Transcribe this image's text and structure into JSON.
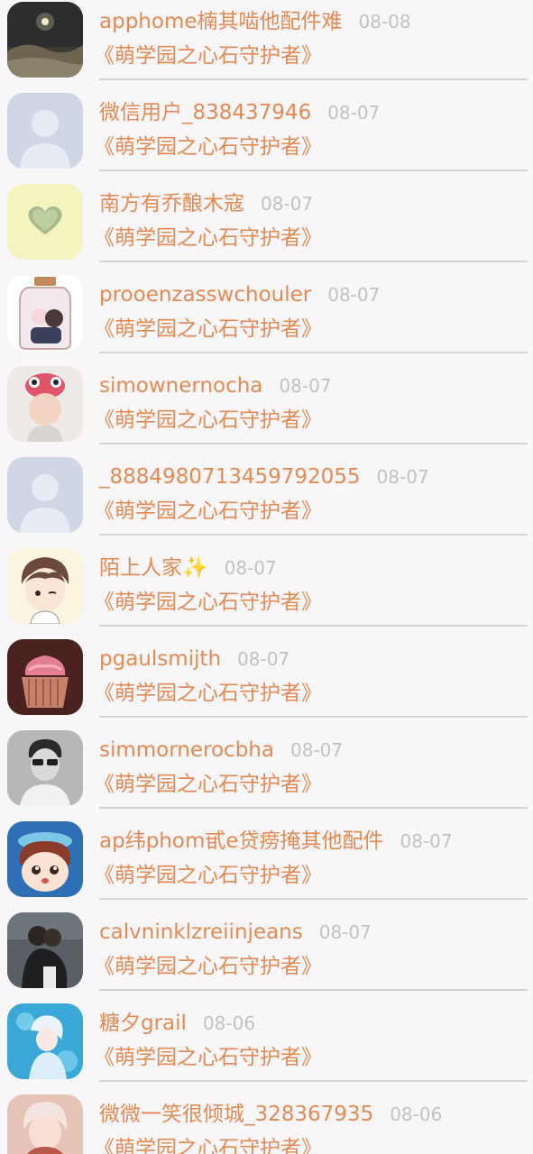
{
  "colors": {
    "background": "#f8f6f8",
    "accent_text": "#e58a52",
    "date_text": "#c4c1c4",
    "divider": "#d6d4d6"
  },
  "items": [
    {
      "name": "apphome楠其啮他配件难",
      "date": "08-08",
      "subtitle": "《萌学园之心石守护者》",
      "avatar_icon": "night-landscape-avatar"
    },
    {
      "name": "微信用户_838437946",
      "date": "08-07",
      "subtitle": "《萌学园之心石守护者》",
      "avatar_icon": "default-person-avatar"
    },
    {
      "name": "南方有乔酿木寇",
      "date": "08-07",
      "subtitle": "《萌学园之心石守护者》",
      "avatar_icon": "heart-avatar"
    },
    {
      "name": "prooenzasswchouler",
      "date": "08-07",
      "subtitle": "《萌学园之心石守护者》",
      "avatar_icon": "jar-illustration-avatar"
    },
    {
      "name": "simownernocha",
      "date": "08-07",
      "subtitle": "《萌学园之心石守护者》",
      "avatar_icon": "baby-photo-avatar"
    },
    {
      "name": "_8884980713459792055",
      "date": "08-07",
      "subtitle": "《萌学园之心石守护者》",
      "avatar_icon": "default-person-avatar"
    },
    {
      "name": "陌上人家✨",
      "date": "08-07",
      "subtitle": "《萌学园之心石守护者》",
      "avatar_icon": "anime-boy-avatar"
    },
    {
      "name": "pgaulsmijth",
      "date": "08-07",
      "subtitle": "《萌学园之心石守护者》",
      "avatar_icon": "cupcake-avatar"
    },
    {
      "name": "simmornerocbha",
      "date": "08-07",
      "subtitle": "《萌学园之心石守护者》",
      "avatar_icon": "bw-portrait-avatar"
    },
    {
      "name": "ap纬phom甙e贷痨掩其他配件",
      "date": "08-07",
      "subtitle": "《萌学园之心石守护者》",
      "avatar_icon": "cartoon-mascot-avatar"
    },
    {
      "name": "calvninklzreiinjeans",
      "date": "08-07",
      "subtitle": "《萌学园之心石守护者》",
      "avatar_icon": "couple-photo-avatar"
    },
    {
      "name": "糖夕grail",
      "date": "08-06",
      "subtitle": "《萌学园之心石守护者》",
      "avatar_icon": "anime-girl-blue-avatar"
    },
    {
      "name": "微微一笑很倾城_328367935",
      "date": "08-06",
      "subtitle": "《萌学园之心石守护者》",
      "avatar_icon": "anime-character-avatar"
    }
  ]
}
